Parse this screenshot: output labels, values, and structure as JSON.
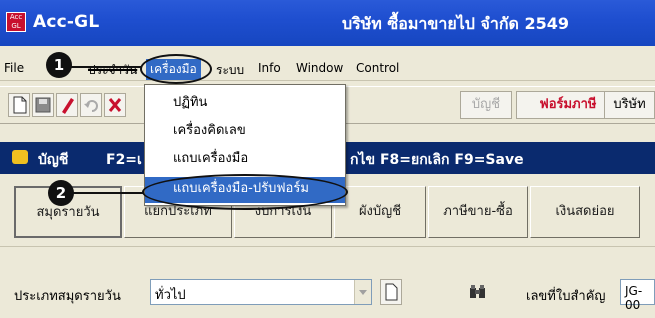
{
  "window": {
    "app_icon_text": "Acc GL",
    "title": "Acc-GL",
    "company": "บริษัท ซื้อมาขายไป จำกัด  2549"
  },
  "menubar": {
    "items": [
      "File",
      "ประจำวัน",
      "เครื่องมือ",
      "ระบบ",
      "Info",
      "Window",
      "Control"
    ]
  },
  "toolbar": {
    "icons": [
      "new-file-icon",
      "save-icon",
      "pencil-icon",
      "undo-icon",
      "close-x-icon"
    ],
    "buttons": [
      "บัญชี",
      "ฟอร์มภาษี",
      "บริษัท"
    ]
  },
  "dropdown": {
    "items": [
      "ปฏิทิน",
      "เครื่องคิดเลข",
      "แถบเครื่องมือ",
      "แถบเครื่องมือ-ปรับฟอร์ม"
    ],
    "highlighted_index": 3
  },
  "darkbar": {
    "title": "บัญชี",
    "hint_prefix": "F2=เ",
    "hint_suffix": "กไข  F8=ยกเลิก  F9=Save"
  },
  "tabs": [
    "สมุดรายวัน",
    "แยกประเภท",
    "งบการเงิน",
    "ผังบัญชี",
    "ภาษีขาย-ซื้อ",
    "เงินสดย่อย"
  ],
  "form": {
    "journal_type_label": "ประเภทสมุดรายวัน",
    "journal_type_value": "ทั่วไป",
    "doc_no_label": "เลขที่ใบสำคัญ",
    "doc_no_value": "JG-00"
  },
  "annotations": {
    "badge_1": "1",
    "badge_2": "2"
  },
  "colors": {
    "titlebar": "#1f4fd0",
    "highlight": "#316ac5",
    "darkbar": "#0a2a6e"
  }
}
